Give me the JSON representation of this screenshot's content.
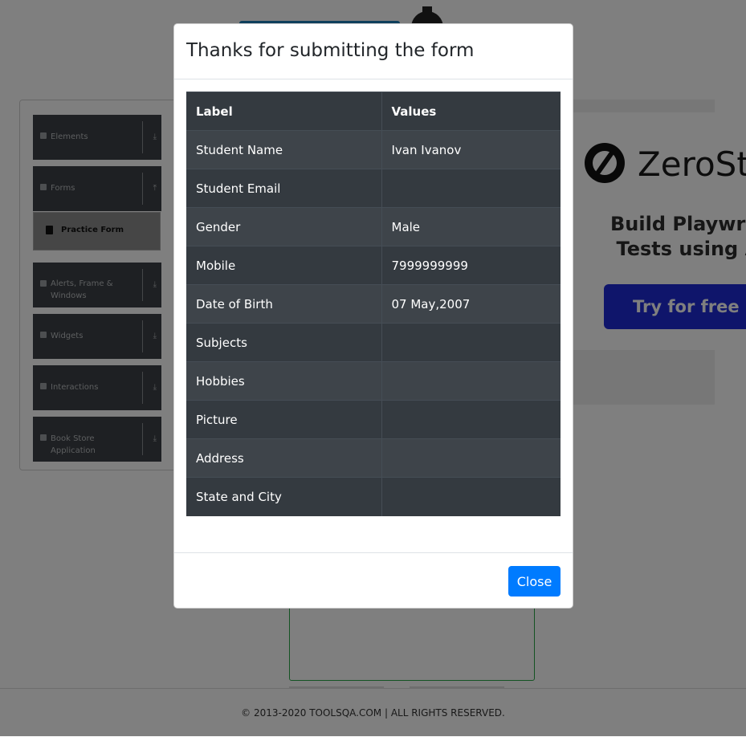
{
  "modal": {
    "title": "Thanks for submitting the form",
    "table": {
      "headers": [
        "Label",
        "Values"
      ],
      "rows": [
        {
          "label": "Student Name",
          "value": "Ivan Ivanov"
        },
        {
          "label": "Student Email",
          "value": ""
        },
        {
          "label": "Gender",
          "value": "Male"
        },
        {
          "label": "Mobile",
          "value": "7999999999"
        },
        {
          "label": "Date of Birth",
          "value": "07 May,2007"
        },
        {
          "label": "Subjects",
          "value": ""
        },
        {
          "label": "Hobbies",
          "value": ""
        },
        {
          "label": "Picture",
          "value": ""
        },
        {
          "label": "Address",
          "value": ""
        },
        {
          "label": "State and City",
          "value": ""
        }
      ]
    },
    "close_label": "Close"
  },
  "sidebar": {
    "groups": [
      {
        "label": "Elements",
        "icon": "list-icon",
        "arrow": "⤓"
      },
      {
        "label": "Forms",
        "icon": "form-icon",
        "arrow": "⤒",
        "items": [
          {
            "label": "Practice Form",
            "icon": "html5-icon"
          }
        ]
      },
      {
        "label": "Alerts, Frame & Windows",
        "icon": "window-icon",
        "arrow": "⤓"
      },
      {
        "label": "Widgets",
        "icon": "widgets-icon",
        "arrow": "⤓"
      },
      {
        "label": "Interactions",
        "icon": "interactions-icon",
        "arrow": "⤓"
      },
      {
        "label": "Book Store Application",
        "icon": "bookstore-icon",
        "arrow": "⤓"
      }
    ]
  },
  "ad": {
    "brand": "ZeroSt",
    "text_line1": "Build Playwrig",
    "text_line2": "Tests using A",
    "cta": "Try for free →"
  },
  "footer": {
    "text": "© 2013-2020 TOOLSQA.COM | ALL RIGHTS RESERVED."
  },
  "colors": {
    "primary": "#007bff",
    "table_dark": "#343a40",
    "table_stripe": "#3e444a",
    "sidebar_group": "#3d4146",
    "ad_cta": "#1f2ad6"
  }
}
